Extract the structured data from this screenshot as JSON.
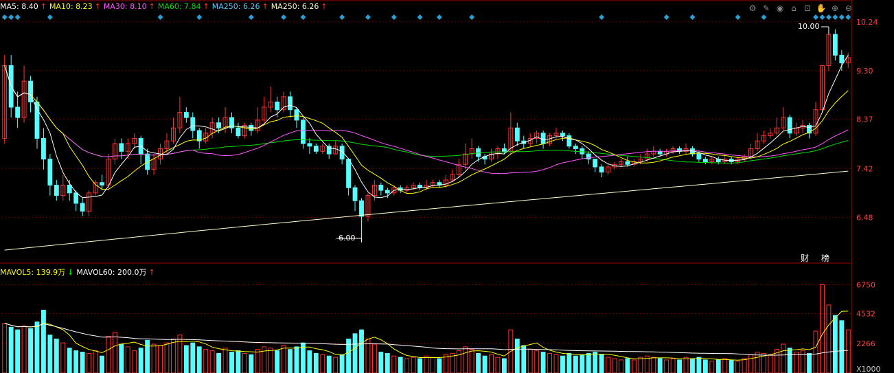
{
  "legend": {
    "ma": [
      {
        "label": "MA5: 8.40",
        "arrow": "↑",
        "color": "#ffffff"
      },
      {
        "label": "MA10: 8.23",
        "arrow": "↑",
        "color": "#ffff00"
      },
      {
        "label": "MA30: 8.10",
        "arrow": "↑",
        "color": "#ff55ff"
      },
      {
        "label": "MA60: 7.84",
        "arrow": "↑",
        "color": "#00dd00"
      },
      {
        "label": "MA250: 6.26",
        "arrow": "↑",
        "color": "#55ccff"
      },
      {
        "label": "MA250: 6.26",
        "arrow": "↑",
        "color": "#ffffcc"
      }
    ],
    "vol": [
      {
        "label": "MAVOL5: 139.9万",
        "arrow": "↓",
        "color": "#ffff00",
        "arrow_color": "#00ff00"
      },
      {
        "label": "MAVOL60: 200.0万",
        "arrow": "↑",
        "color": "#ffffff",
        "arrow_color": "#ff3333"
      }
    ]
  },
  "toolbar": {
    "icons": [
      {
        "name": "settings-icon",
        "glyph": "⚙"
      },
      {
        "name": "draw-icon",
        "glyph": "✎"
      },
      {
        "name": "eye-icon",
        "glyph": "◉"
      },
      {
        "name": "export-icon",
        "glyph": "⌂"
      },
      {
        "name": "lock-icon",
        "glyph": "⊡"
      },
      {
        "name": "hand-icon",
        "glyph": "✋"
      },
      {
        "name": "zoom-in-icon",
        "glyph": "⊕"
      },
      {
        "name": "zoom-out-icon",
        "glyph": "⊖"
      }
    ]
  },
  "price_axis_labels": [
    "10.24",
    "9.30",
    "8.37",
    "7.42",
    "6.48"
  ],
  "volume_axis_labels": [
    "6750",
    "4532",
    "2266",
    "X1000"
  ],
  "markers": {
    "high_label": "10.00",
    "low_label": "6.00"
  },
  "side_buttons": {
    "finance": "财",
    "ranking": "榜"
  },
  "colors": {
    "up": "#ff3333",
    "down": "#54ffff",
    "grid": "#7a0000",
    "axis_text": "#ff4040",
    "ma5": "#ffffff",
    "ma10": "#ffff00",
    "ma30": "#ff55ff",
    "ma60": "#00dd00",
    "ma250": "#ffffcc",
    "vol_ma5": "#ffff00",
    "vol_ma60": "#ffffff",
    "signal": "#2a9fd6"
  },
  "chart_data": {
    "type": "candlestick",
    "price_ylim": [
      5.6,
      10.45
    ],
    "volume_ylim": [
      0,
      7400
    ],
    "high_value": 10.0,
    "low_value": 6.0,
    "candles": [
      [
        8.0,
        9.4,
        9.6,
        7.9,
        3800
      ],
      [
        9.4,
        8.6,
        9.6,
        8.4,
        3500
      ],
      [
        8.6,
        8.4,
        8.9,
        8.2,
        3300
      ],
      [
        8.4,
        9.1,
        9.4,
        8.3,
        3600
      ],
      [
        9.1,
        8.7,
        9.2,
        8.5,
        3400
      ],
      [
        8.7,
        8.0,
        8.8,
        7.8,
        3900
      ],
      [
        8.0,
        7.6,
        8.2,
        7.4,
        4800
      ],
      [
        7.6,
        7.1,
        7.7,
        6.9,
        2900
      ],
      [
        7.1,
        6.9,
        7.2,
        6.8,
        2600
      ],
      [
        6.9,
        7.1,
        7.3,
        6.8,
        2300
      ],
      [
        7.1,
        6.95,
        7.2,
        6.8,
        1900
      ],
      [
        6.95,
        6.75,
        7.0,
        6.6,
        1700
      ],
      [
        6.75,
        6.6,
        6.85,
        6.5,
        1600
      ],
      [
        6.6,
        6.95,
        7.0,
        6.5,
        1500
      ],
      [
        6.95,
        7.15,
        7.2,
        6.9,
        1700
      ],
      [
        7.15,
        7.1,
        7.3,
        7.0,
        1300
      ],
      [
        7.1,
        7.6,
        7.7,
        7.0,
        2800
      ],
      [
        7.6,
        7.9,
        8.0,
        7.5,
        3100
      ],
      [
        7.9,
        7.75,
        8.0,
        7.6,
        2200
      ],
      [
        7.75,
        7.9,
        8.0,
        7.6,
        2000
      ],
      [
        7.9,
        8.0,
        8.1,
        7.8,
        1700
      ],
      [
        8.0,
        7.7,
        8.05,
        7.5,
        1900
      ],
      [
        7.7,
        7.4,
        7.8,
        7.3,
        2500
      ],
      [
        7.4,
        7.6,
        7.7,
        7.3,
        2200
      ],
      [
        7.6,
        7.8,
        7.9,
        7.5,
        2100
      ],
      [
        7.8,
        7.95,
        8.1,
        7.7,
        2300
      ],
      [
        7.95,
        8.2,
        8.4,
        7.9,
        2600
      ],
      [
        8.2,
        8.5,
        8.8,
        8.1,
        2900
      ],
      [
        8.5,
        8.4,
        8.6,
        8.3,
        2100
      ],
      [
        8.4,
        8.15,
        8.5,
        8.0,
        2300
      ],
      [
        8.15,
        7.95,
        8.2,
        7.8,
        2000
      ],
      [
        7.95,
        8.1,
        8.2,
        7.9,
        1800
      ],
      [
        8.1,
        8.3,
        8.4,
        8.0,
        1700
      ],
      [
        8.3,
        8.2,
        8.4,
        8.1,
        1500
      ],
      [
        8.2,
        8.4,
        8.6,
        8.1,
        1900
      ],
      [
        8.4,
        8.2,
        8.5,
        8.1,
        1600
      ],
      [
        8.2,
        8.05,
        8.3,
        8.0,
        1700
      ],
      [
        8.05,
        8.25,
        8.3,
        8.0,
        1500
      ],
      [
        8.25,
        8.15,
        8.3,
        8.05,
        1400
      ],
      [
        8.15,
        8.35,
        8.6,
        8.1,
        1800
      ],
      [
        8.35,
        8.6,
        8.8,
        8.3,
        2000
      ],
      [
        8.6,
        8.7,
        9.0,
        8.5,
        1900
      ],
      [
        8.7,
        8.55,
        8.8,
        8.4,
        1700
      ],
      [
        8.55,
        8.8,
        8.9,
        8.5,
        2100
      ],
      [
        8.8,
        8.55,
        8.9,
        8.4,
        1800
      ],
      [
        8.55,
        8.35,
        8.6,
        8.2,
        2000
      ],
      [
        8.35,
        7.9,
        8.4,
        7.8,
        2300
      ],
      [
        7.9,
        7.85,
        8.0,
        7.7,
        1700
      ],
      [
        7.85,
        7.75,
        7.9,
        7.7,
        1500
      ],
      [
        7.75,
        7.85,
        7.9,
        7.7,
        1400
      ],
      [
        7.85,
        7.7,
        7.9,
        7.6,
        1300
      ],
      [
        7.7,
        7.85,
        7.95,
        7.7,
        1200
      ],
      [
        7.85,
        7.6,
        7.9,
        7.5,
        1400
      ],
      [
        7.6,
        7.05,
        7.6,
        6.9,
        2600
      ],
      [
        7.05,
        6.8,
        7.1,
        6.6,
        3000
      ],
      [
        6.8,
        6.5,
        6.85,
        6.0,
        3300
      ],
      [
        6.5,
        6.9,
        6.95,
        6.4,
        2600
      ],
      [
        6.9,
        7.1,
        7.2,
        6.8,
        2200
      ],
      [
        7.1,
        7.0,
        7.15,
        6.9,
        1600
      ],
      [
        7.0,
        6.95,
        7.05,
        6.85,
        1500
      ],
      [
        6.95,
        7.05,
        7.1,
        6.9,
        1300
      ],
      [
        7.05,
        7.0,
        7.1,
        6.95,
        1200
      ],
      [
        7.0,
        7.05,
        7.1,
        6.95,
        1100
      ],
      [
        7.05,
        7.1,
        7.15,
        7.0,
        1200
      ],
      [
        7.1,
        7.05,
        7.15,
        7.0,
        1100
      ],
      [
        7.05,
        7.1,
        7.2,
        7.0,
        1300
      ],
      [
        7.1,
        7.15,
        7.2,
        7.05,
        1200
      ],
      [
        7.15,
        7.1,
        7.2,
        7.05,
        1100
      ],
      [
        7.1,
        7.2,
        7.3,
        7.05,
        1400
      ],
      [
        7.2,
        7.3,
        7.4,
        7.15,
        1500
      ],
      [
        7.3,
        7.5,
        7.6,
        7.25,
        1700
      ],
      [
        7.5,
        7.7,
        7.9,
        7.4,
        2000
      ],
      [
        7.7,
        7.8,
        8.0,
        7.6,
        1800
      ],
      [
        7.8,
        7.65,
        7.85,
        7.55,
        1500
      ],
      [
        7.65,
        7.6,
        7.7,
        7.5,
        1300
      ],
      [
        7.6,
        7.7,
        7.8,
        7.55,
        1400
      ],
      [
        7.7,
        7.8,
        7.85,
        7.6,
        1200
      ],
      [
        7.8,
        7.75,
        7.9,
        7.7,
        1100
      ],
      [
        7.75,
        8.2,
        8.5,
        7.7,
        3300
      ],
      [
        8.2,
        7.95,
        8.3,
        7.85,
        2600
      ],
      [
        7.95,
        7.9,
        8.05,
        7.8,
        2100
      ],
      [
        7.9,
        8.0,
        8.1,
        7.85,
        1800
      ],
      [
        8.0,
        8.1,
        8.15,
        7.9,
        1700
      ],
      [
        8.1,
        7.9,
        8.15,
        7.8,
        1600
      ],
      [
        7.9,
        8.05,
        8.1,
        7.85,
        1500
      ],
      [
        8.05,
        8.1,
        8.2,
        8.0,
        1400
      ],
      [
        8.1,
        8.05,
        8.15,
        7.95,
        1300
      ],
      [
        8.05,
        7.85,
        8.1,
        7.8,
        1500
      ],
      [
        7.85,
        7.8,
        7.9,
        7.7,
        1300
      ],
      [
        7.8,
        7.7,
        7.85,
        7.6,
        1400
      ],
      [
        7.7,
        7.6,
        7.75,
        7.5,
        1500
      ],
      [
        7.6,
        7.45,
        7.6,
        7.35,
        1600
      ],
      [
        7.45,
        7.35,
        7.5,
        7.25,
        1400
      ],
      [
        7.35,
        7.45,
        7.5,
        7.3,
        1200
      ],
      [
        7.45,
        7.5,
        7.55,
        7.4,
        1100
      ],
      [
        7.5,
        7.55,
        7.6,
        7.45,
        1000
      ],
      [
        7.55,
        7.5,
        7.65,
        7.45,
        1100
      ],
      [
        7.5,
        7.55,
        7.6,
        7.45,
        1000
      ],
      [
        7.55,
        7.6,
        7.7,
        7.5,
        1200
      ],
      [
        7.6,
        7.7,
        7.8,
        7.55,
        1300
      ],
      [
        7.7,
        7.75,
        7.85,
        7.65,
        1200
      ],
      [
        7.75,
        7.7,
        7.8,
        7.65,
        1100
      ],
      [
        7.7,
        7.75,
        7.8,
        7.65,
        1000
      ],
      [
        7.75,
        7.8,
        7.85,
        7.7,
        1100
      ],
      [
        7.8,
        7.75,
        7.85,
        7.7,
        1000
      ],
      [
        7.75,
        7.8,
        7.9,
        7.7,
        1200
      ],
      [
        7.8,
        7.7,
        7.85,
        7.65,
        1100
      ],
      [
        7.7,
        7.6,
        7.75,
        7.55,
        1200
      ],
      [
        7.6,
        7.55,
        7.65,
        7.5,
        1000
      ],
      [
        7.55,
        7.6,
        7.65,
        7.5,
        900
      ],
      [
        7.6,
        7.55,
        7.65,
        7.5,
        1000
      ],
      [
        7.55,
        7.6,
        7.7,
        7.5,
        1100
      ],
      [
        7.6,
        7.55,
        7.65,
        7.5,
        1000
      ],
      [
        7.55,
        7.6,
        7.65,
        7.5,
        900
      ],
      [
        7.6,
        7.65,
        7.7,
        7.55,
        1100
      ],
      [
        7.65,
        7.8,
        7.9,
        7.6,
        1400
      ],
      [
        7.8,
        7.95,
        8.1,
        7.75,
        1600
      ],
      [
        7.95,
        8.05,
        8.15,
        7.9,
        1500
      ],
      [
        8.05,
        8.1,
        8.2,
        8.0,
        1400
      ],
      [
        8.1,
        8.2,
        8.4,
        8.05,
        1800
      ],
      [
        8.2,
        8.4,
        8.6,
        8.15,
        2200
      ],
      [
        8.4,
        8.1,
        8.45,
        8.0,
        1900
      ],
      [
        8.1,
        8.2,
        8.3,
        8.05,
        1600
      ],
      [
        8.2,
        8.25,
        8.35,
        8.1,
        1700
      ],
      [
        8.25,
        8.1,
        8.3,
        8.0,
        1500
      ],
      [
        8.1,
        8.55,
        8.7,
        8.05,
        3200
      ],
      [
        8.55,
        9.4,
        9.4,
        8.5,
        6750
      ],
      [
        9.4,
        10.0,
        10.0,
        9.3,
        5200
      ],
      [
        10.0,
        9.6,
        10.1,
        9.5,
        4400
      ],
      [
        9.6,
        9.45,
        9.7,
        9.3,
        4000
      ],
      [
        9.45,
        9.55,
        9.65,
        9.35,
        3300
      ]
    ]
  }
}
